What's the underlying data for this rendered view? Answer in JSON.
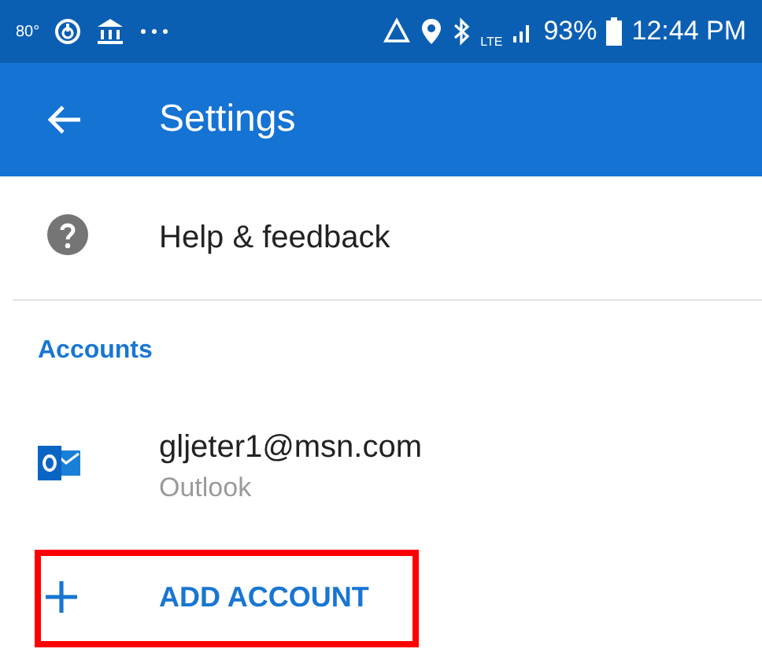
{
  "status_bar": {
    "temperature": "80°",
    "network": "LTE",
    "battery": "93%",
    "time": "12:44 PM"
  },
  "app_bar": {
    "title": "Settings"
  },
  "menu_items": [
    {
      "label": "Help & feedback"
    }
  ],
  "accounts": {
    "heading": "Accounts",
    "items": [
      {
        "email": "gljeter1@msn.com",
        "provider": "Outlook"
      }
    ]
  },
  "add_account": {
    "label": "ADD ACCOUNT",
    "highlighted": true
  }
}
